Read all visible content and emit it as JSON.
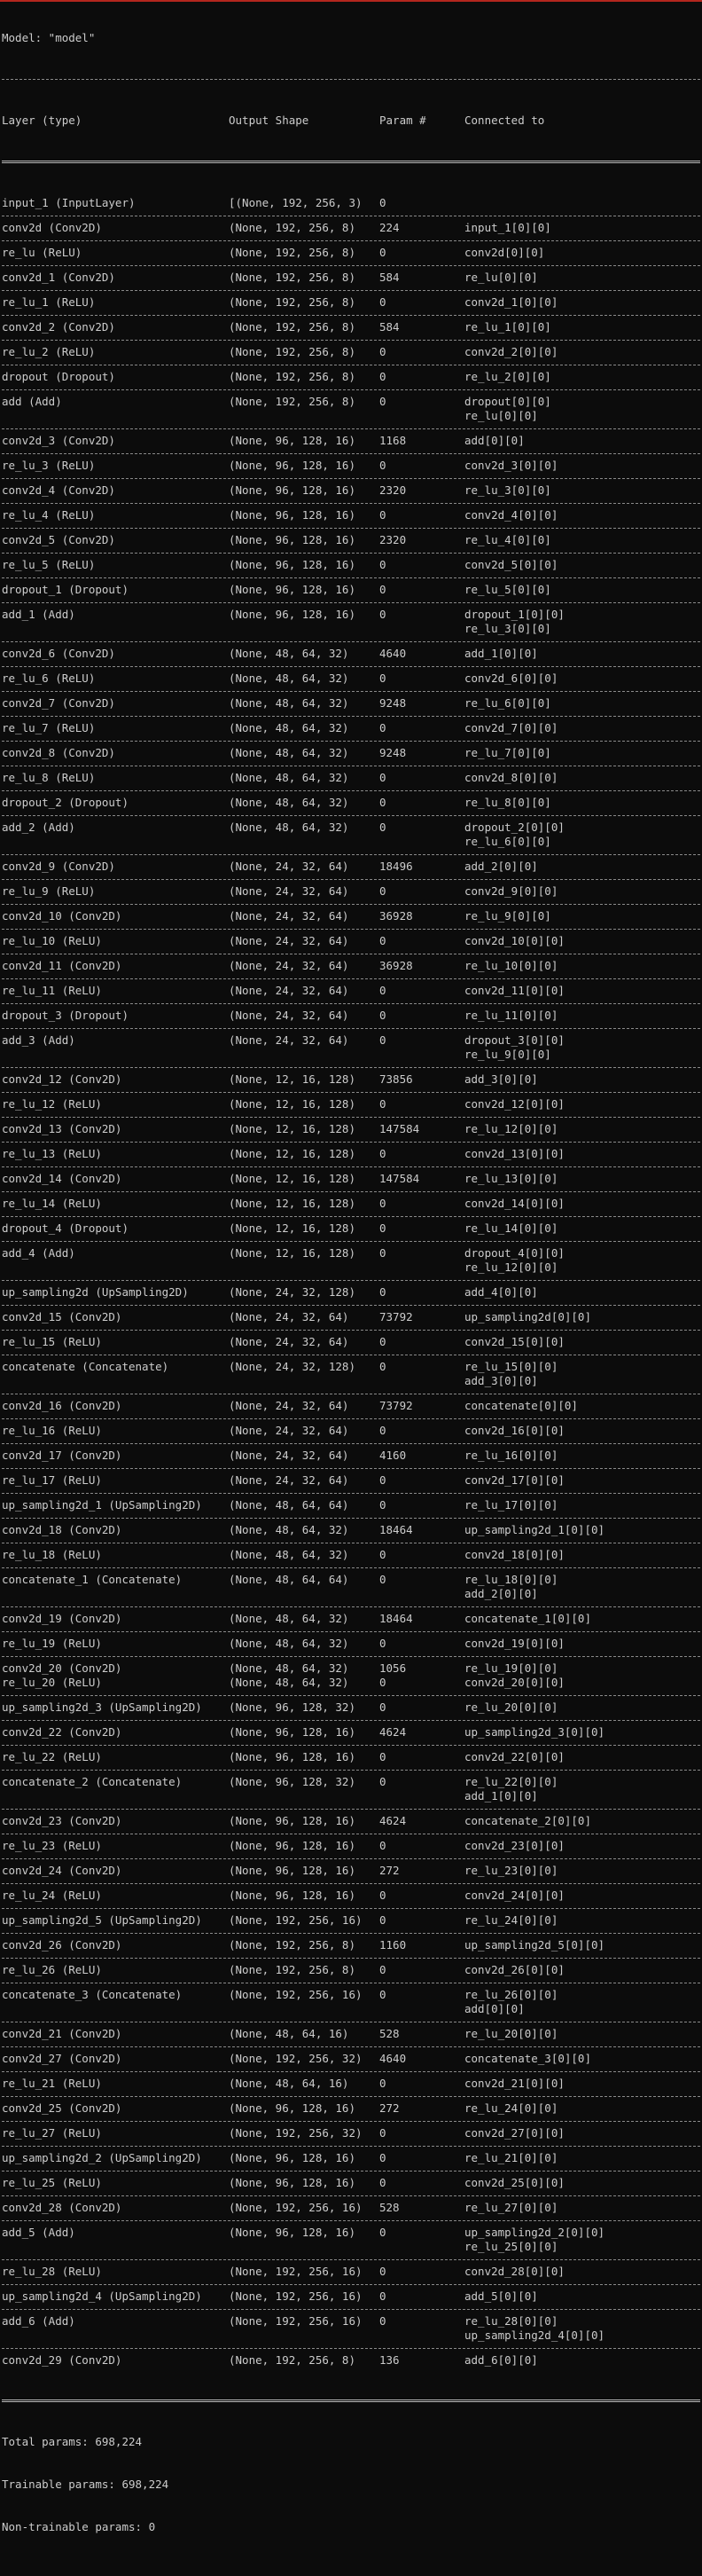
{
  "model_title": "Model: \"model\"",
  "columns": {
    "layer": "Layer (type)",
    "output_shape": "Output Shape",
    "params": "Param #",
    "connected": "Connected to"
  },
  "layers": [
    {
      "layer": "input_1 (InputLayer)",
      "output_shape": "[(None, 192, 256, 3)",
      "params": "0",
      "connected": []
    },
    {
      "layer": "conv2d (Conv2D)",
      "output_shape": "(None, 192, 256, 8)",
      "params": "224",
      "connected": [
        "input_1[0][0]"
      ]
    },
    {
      "layer": "re_lu (ReLU)",
      "output_shape": "(None, 192, 256, 8)",
      "params": "0",
      "connected": [
        "conv2d[0][0]"
      ]
    },
    {
      "layer": "conv2d_1 (Conv2D)",
      "output_shape": "(None, 192, 256, 8)",
      "params": "584",
      "connected": [
        "re_lu[0][0]"
      ]
    },
    {
      "layer": "re_lu_1 (ReLU)",
      "output_shape": "(None, 192, 256, 8)",
      "params": "0",
      "connected": [
        "conv2d_1[0][0]"
      ]
    },
    {
      "layer": "conv2d_2 (Conv2D)",
      "output_shape": "(None, 192, 256, 8)",
      "params": "584",
      "connected": [
        "re_lu_1[0][0]"
      ]
    },
    {
      "layer": "re_lu_2 (ReLU)",
      "output_shape": "(None, 192, 256, 8)",
      "params": "0",
      "connected": [
        "conv2d_2[0][0]"
      ]
    },
    {
      "layer": "dropout (Dropout)",
      "output_shape": "(None, 192, 256, 8)",
      "params": "0",
      "connected": [
        "re_lu_2[0][0]"
      ]
    },
    {
      "layer": "add (Add)",
      "output_shape": "(None, 192, 256, 8)",
      "params": "0",
      "connected": [
        "dropout[0][0]",
        "re_lu[0][0]"
      ]
    },
    {
      "layer": "conv2d_3 (Conv2D)",
      "output_shape": "(None, 96, 128, 16)",
      "params": "1168",
      "connected": [
        "add[0][0]"
      ]
    },
    {
      "layer": "re_lu_3 (ReLU)",
      "output_shape": "(None, 96, 128, 16)",
      "params": "0",
      "connected": [
        "conv2d_3[0][0]"
      ]
    },
    {
      "layer": "conv2d_4 (Conv2D)",
      "output_shape": "(None, 96, 128, 16)",
      "params": "2320",
      "connected": [
        "re_lu_3[0][0]"
      ]
    },
    {
      "layer": "re_lu_4 (ReLU)",
      "output_shape": "(None, 96, 128, 16)",
      "params": "0",
      "connected": [
        "conv2d_4[0][0]"
      ]
    },
    {
      "layer": "conv2d_5 (Conv2D)",
      "output_shape": "(None, 96, 128, 16)",
      "params": "2320",
      "connected": [
        "re_lu_4[0][0]"
      ]
    },
    {
      "layer": "re_lu_5 (ReLU)",
      "output_shape": "(None, 96, 128, 16)",
      "params": "0",
      "connected": [
        "conv2d_5[0][0]"
      ]
    },
    {
      "layer": "dropout_1 (Dropout)",
      "output_shape": "(None, 96, 128, 16)",
      "params": "0",
      "connected": [
        "re_lu_5[0][0]"
      ]
    },
    {
      "layer": "add_1 (Add)",
      "output_shape": "(None, 96, 128, 16)",
      "params": "0",
      "connected": [
        "dropout_1[0][0]",
        "re_lu_3[0][0]"
      ]
    },
    {
      "layer": "conv2d_6 (Conv2D)",
      "output_shape": "(None, 48, 64, 32)",
      "params": "4640",
      "connected": [
        "add_1[0][0]"
      ]
    },
    {
      "layer": "re_lu_6 (ReLU)",
      "output_shape": "(None, 48, 64, 32)",
      "params": "0",
      "connected": [
        "conv2d_6[0][0]"
      ]
    },
    {
      "layer": "conv2d_7 (Conv2D)",
      "output_shape": "(None, 48, 64, 32)",
      "params": "9248",
      "connected": [
        "re_lu_6[0][0]"
      ]
    },
    {
      "layer": "re_lu_7 (ReLU)",
      "output_shape": "(None, 48, 64, 32)",
      "params": "0",
      "connected": [
        "conv2d_7[0][0]"
      ]
    },
    {
      "layer": "conv2d_8 (Conv2D)",
      "output_shape": "(None, 48, 64, 32)",
      "params": "9248",
      "connected": [
        "re_lu_7[0][0]"
      ]
    },
    {
      "layer": "re_lu_8 (ReLU)",
      "output_shape": "(None, 48, 64, 32)",
      "params": "0",
      "connected": [
        "conv2d_8[0][0]"
      ]
    },
    {
      "layer": "dropout_2 (Dropout)",
      "output_shape": "(None, 48, 64, 32)",
      "params": "0",
      "connected": [
        "re_lu_8[0][0]"
      ]
    },
    {
      "layer": "add_2 (Add)",
      "output_shape": "(None, 48, 64, 32)",
      "params": "0",
      "connected": [
        "dropout_2[0][0]",
        "re_lu_6[0][0]"
      ]
    },
    {
      "layer": "conv2d_9 (Conv2D)",
      "output_shape": "(None, 24, 32, 64)",
      "params": "18496",
      "connected": [
        "add_2[0][0]"
      ]
    },
    {
      "layer": "re_lu_9 (ReLU)",
      "output_shape": "(None, 24, 32, 64)",
      "params": "0",
      "connected": [
        "conv2d_9[0][0]"
      ]
    },
    {
      "layer": "conv2d_10 (Conv2D)",
      "output_shape": "(None, 24, 32, 64)",
      "params": "36928",
      "connected": [
        "re_lu_9[0][0]"
      ]
    },
    {
      "layer": "re_lu_10 (ReLU)",
      "output_shape": "(None, 24, 32, 64)",
      "params": "0",
      "connected": [
        "conv2d_10[0][0]"
      ]
    },
    {
      "layer": "conv2d_11 (Conv2D)",
      "output_shape": "(None, 24, 32, 64)",
      "params": "36928",
      "connected": [
        "re_lu_10[0][0]"
      ]
    },
    {
      "layer": "re_lu_11 (ReLU)",
      "output_shape": "(None, 24, 32, 64)",
      "params": "0",
      "connected": [
        "conv2d_11[0][0]"
      ]
    },
    {
      "layer": "dropout_3 (Dropout)",
      "output_shape": "(None, 24, 32, 64)",
      "params": "0",
      "connected": [
        "re_lu_11[0][0]"
      ]
    },
    {
      "layer": "add_3 (Add)",
      "output_shape": "(None, 24, 32, 64)",
      "params": "0",
      "connected": [
        "dropout_3[0][0]",
        "re_lu_9[0][0]"
      ]
    },
    {
      "layer": "conv2d_12 (Conv2D)",
      "output_shape": "(None, 12, 16, 128)",
      "params": "73856",
      "connected": [
        "add_3[0][0]"
      ]
    },
    {
      "layer": "re_lu_12 (ReLU)",
      "output_shape": "(None, 12, 16, 128)",
      "params": "0",
      "connected": [
        "conv2d_12[0][0]"
      ]
    },
    {
      "layer": "conv2d_13 (Conv2D)",
      "output_shape": "(None, 12, 16, 128)",
      "params": "147584",
      "connected": [
        "re_lu_12[0][0]"
      ]
    },
    {
      "layer": "re_lu_13 (ReLU)",
      "output_shape": "(None, 12, 16, 128)",
      "params": "0",
      "connected": [
        "conv2d_13[0][0]"
      ]
    },
    {
      "layer": "conv2d_14 (Conv2D)",
      "output_shape": "(None, 12, 16, 128)",
      "params": "147584",
      "connected": [
        "re_lu_13[0][0]"
      ]
    },
    {
      "layer": "re_lu_14 (ReLU)",
      "output_shape": "(None, 12, 16, 128)",
      "params": "0",
      "connected": [
        "conv2d_14[0][0]"
      ]
    },
    {
      "layer": "dropout_4 (Dropout)",
      "output_shape": "(None, 12, 16, 128)",
      "params": "0",
      "connected": [
        "re_lu_14[0][0]"
      ]
    },
    {
      "layer": "add_4 (Add)",
      "output_shape": "(None, 12, 16, 128)",
      "params": "0",
      "connected": [
        "dropout_4[0][0]",
        "re_lu_12[0][0]"
      ]
    },
    {
      "layer": "up_sampling2d (UpSampling2D)",
      "output_shape": "(None, 24, 32, 128)",
      "params": "0",
      "connected": [
        "add_4[0][0]"
      ]
    },
    {
      "layer": "conv2d_15 (Conv2D)",
      "output_shape": "(None, 24, 32, 64)",
      "params": "73792",
      "connected": [
        "up_sampling2d[0][0]"
      ]
    },
    {
      "layer": "re_lu_15 (ReLU)",
      "output_shape": "(None, 24, 32, 64)",
      "params": "0",
      "connected": [
        "conv2d_15[0][0]"
      ]
    },
    {
      "layer": "concatenate (Concatenate)",
      "output_shape": "(None, 24, 32, 128)",
      "params": "0",
      "connected": [
        "re_lu_15[0][0]",
        "add_3[0][0]"
      ]
    },
    {
      "layer": "conv2d_16 (Conv2D)",
      "output_shape": "(None, 24, 32, 64)",
      "params": "73792",
      "connected": [
        "concatenate[0][0]"
      ]
    },
    {
      "layer": "re_lu_16 (ReLU)",
      "output_shape": "(None, 24, 32, 64)",
      "params": "0",
      "connected": [
        "conv2d_16[0][0]"
      ]
    },
    {
      "layer": "conv2d_17 (Conv2D)",
      "output_shape": "(None, 24, 32, 64)",
      "params": "4160",
      "connected": [
        "re_lu_16[0][0]"
      ]
    },
    {
      "layer": "re_lu_17 (ReLU)",
      "output_shape": "(None, 24, 32, 64)",
      "params": "0",
      "connected": [
        "conv2d_17[0][0]"
      ]
    },
    {
      "layer": "up_sampling2d_1 (UpSampling2D)",
      "output_shape": "(None, 48, 64, 64)",
      "params": "0",
      "connected": [
        "re_lu_17[0][0]"
      ]
    },
    {
      "layer": "conv2d_18 (Conv2D)",
      "output_shape": "(None, 48, 64, 32)",
      "params": "18464",
      "connected": [
        "up_sampling2d_1[0][0]"
      ]
    },
    {
      "layer": "re_lu_18 (ReLU)",
      "output_shape": "(None, 48, 64, 32)",
      "params": "0",
      "connected": [
        "conv2d_18[0][0]"
      ]
    },
    {
      "layer": "concatenate_1 (Concatenate)",
      "output_shape": "(None, 48, 64, 64)",
      "params": "0",
      "connected": [
        "re_lu_18[0][0]",
        "add_2[0][0]"
      ]
    },
    {
      "layer": "conv2d_19 (Conv2D)",
      "output_shape": "(None, 48, 64, 32)",
      "params": "18464",
      "connected": [
        "concatenate_1[0][0]"
      ]
    },
    {
      "layer": "re_lu_19 (ReLU)",
      "output_shape": "(None, 48, 64, 32)",
      "params": "0",
      "connected": [
        "conv2d_19[0][0]"
      ]
    },
    {
      "layer": "conv2d_20 (Conv2D)",
      "output_shape": "(None, 48, 64, 32)",
      "params": "1056",
      "connected": [
        "re_lu_19[0][0]"
      ],
      "no_sep": true
    },
    {
      "layer": "re_lu_20 (ReLU)",
      "output_shape": "(None, 48, 64, 32)",
      "params": "0",
      "connected": [
        "conv2d_20[0][0]"
      ]
    },
    {
      "layer": "up_sampling2d_3 (UpSampling2D)",
      "output_shape": "(None, 96, 128, 32)",
      "params": "0",
      "connected": [
        "re_lu_20[0][0]"
      ]
    },
    {
      "layer": "conv2d_22 (Conv2D)",
      "output_shape": "(None, 96, 128, 16)",
      "params": "4624",
      "connected": [
        "up_sampling2d_3[0][0]"
      ]
    },
    {
      "layer": "re_lu_22 (ReLU)",
      "output_shape": "(None, 96, 128, 16)",
      "params": "0",
      "connected": [
        "conv2d_22[0][0]"
      ]
    },
    {
      "layer": "concatenate_2 (Concatenate)",
      "output_shape": "(None, 96, 128, 32)",
      "params": "0",
      "connected": [
        "re_lu_22[0][0]",
        "add_1[0][0]"
      ]
    },
    {
      "layer": "conv2d_23 (Conv2D)",
      "output_shape": "(None, 96, 128, 16)",
      "params": "4624",
      "connected": [
        "concatenate_2[0][0]"
      ]
    },
    {
      "layer": "re_lu_23 (ReLU)",
      "output_shape": "(None, 96, 128, 16)",
      "params": "0",
      "connected": [
        "conv2d_23[0][0]"
      ]
    },
    {
      "layer": "conv2d_24 (Conv2D)",
      "output_shape": "(None, 96, 128, 16)",
      "params": "272",
      "connected": [
        "re_lu_23[0][0]"
      ]
    },
    {
      "layer": "re_lu_24 (ReLU)",
      "output_shape": "(None, 96, 128, 16)",
      "params": "0",
      "connected": [
        "conv2d_24[0][0]"
      ]
    },
    {
      "layer": "up_sampling2d_5 (UpSampling2D)",
      "output_shape": "(None, 192, 256, 16)",
      "params": "0",
      "connected": [
        "re_lu_24[0][0]"
      ]
    },
    {
      "layer": "conv2d_26 (Conv2D)",
      "output_shape": "(None, 192, 256, 8)",
      "params": "1160",
      "connected": [
        "up_sampling2d_5[0][0]"
      ]
    },
    {
      "layer": "re_lu_26 (ReLU)",
      "output_shape": "(None, 192, 256, 8)",
      "params": "0",
      "connected": [
        "conv2d_26[0][0]"
      ]
    },
    {
      "layer": "concatenate_3 (Concatenate)",
      "output_shape": "(None, 192, 256, 16)",
      "params": "0",
      "connected": [
        "re_lu_26[0][0]",
        "add[0][0]"
      ]
    },
    {
      "layer": "conv2d_21 (Conv2D)",
      "output_shape": "(None, 48, 64, 16)",
      "params": "528",
      "connected": [
        "re_lu_20[0][0]"
      ]
    },
    {
      "layer": "conv2d_27 (Conv2D)",
      "output_shape": "(None, 192, 256, 32)",
      "params": "4640",
      "connected": [
        "concatenate_3[0][0]"
      ]
    },
    {
      "layer": "re_lu_21 (ReLU)",
      "output_shape": "(None, 48, 64, 16)",
      "params": "0",
      "connected": [
        "conv2d_21[0][0]"
      ]
    },
    {
      "layer": "conv2d_25 (Conv2D)",
      "output_shape": "(None, 96, 128, 16)",
      "params": "272",
      "connected": [
        "re_lu_24[0][0]"
      ]
    },
    {
      "layer": "re_lu_27 (ReLU)",
      "output_shape": "(None, 192, 256, 32)",
      "params": "0",
      "connected": [
        "conv2d_27[0][0]"
      ]
    },
    {
      "layer": "up_sampling2d_2 (UpSampling2D)",
      "output_shape": "(None, 96, 128, 16)",
      "params": "0",
      "connected": [
        "re_lu_21[0][0]"
      ]
    },
    {
      "layer": "re_lu_25 (ReLU)",
      "output_shape": "(None, 96, 128, 16)",
      "params": "0",
      "connected": [
        "conv2d_25[0][0]"
      ]
    },
    {
      "layer": "conv2d_28 (Conv2D)",
      "output_shape": "(None, 192, 256, 16)",
      "params": "528",
      "connected": [
        "re_lu_27[0][0]"
      ]
    },
    {
      "layer": "add_5 (Add)",
      "output_shape": "(None, 96, 128, 16)",
      "params": "0",
      "connected": [
        "up_sampling2d_2[0][0]",
        "re_lu_25[0][0]"
      ]
    },
    {
      "layer": "re_lu_28 (ReLU)",
      "output_shape": "(None, 192, 256, 16)",
      "params": "0",
      "connected": [
        "conv2d_28[0][0]"
      ]
    },
    {
      "layer": "up_sampling2d_4 (UpSampling2D)",
      "output_shape": "(None, 192, 256, 16)",
      "params": "0",
      "connected": [
        "add_5[0][0]"
      ]
    },
    {
      "layer": "add_6 (Add)",
      "output_shape": "(None, 192, 256, 16)",
      "params": "0",
      "connected": [
        "re_lu_28[0][0]",
        "up_sampling2d_4[0][0]"
      ]
    },
    {
      "layer": "conv2d_29 (Conv2D)",
      "output_shape": "(None, 192, 256, 8)",
      "params": "136",
      "connected": [
        "add_6[0][0]"
      ]
    }
  ],
  "summary": {
    "total": "Total params: 698,224",
    "trainable": "Trainable params: 698,224",
    "non_trainable": "Non-trainable params: 0"
  },
  "colors": {
    "background": "#0c0c0c",
    "text": "#cccccc",
    "top_accent": "#b3261e"
  }
}
